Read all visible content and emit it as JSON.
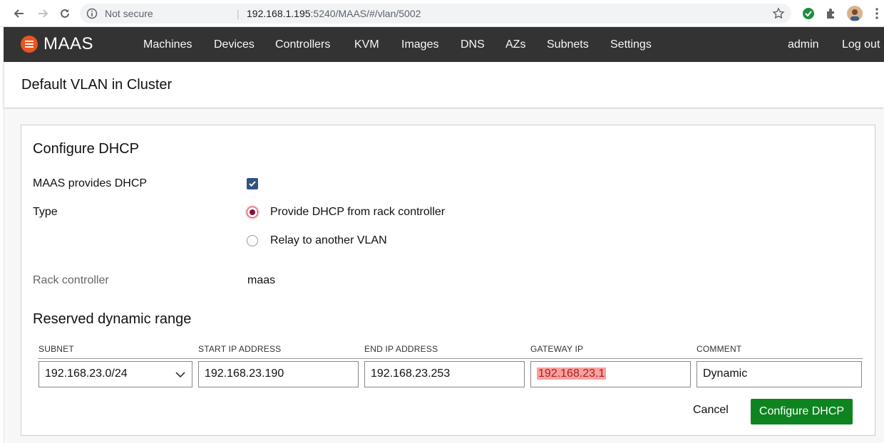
{
  "browser": {
    "security_label": "Not secure",
    "url_host": "192.168.1.195",
    "url_rest": ":5240/MAAS/#/vlan/5002"
  },
  "header": {
    "logo_text": "MAAS",
    "brand_color": "#e95420",
    "nav": [
      "Machines",
      "Devices",
      "Controllers",
      "KVM",
      "Images",
      "DNS",
      "AZs",
      "Subnets",
      "Settings"
    ],
    "user": "admin",
    "logout": "Log out"
  },
  "page": {
    "title": "Default VLAN in Cluster"
  },
  "dhcp": {
    "title": "Configure DHCP",
    "provides_label": "MAAS provides DHCP",
    "provides_checked": true,
    "type_label": "Type",
    "type_options": [
      "Provide DHCP from rack controller",
      "Relay to another VLAN"
    ],
    "type_selected": "Provide DHCP from rack controller",
    "rack_label": "Rack controller",
    "rack_value": "maas"
  },
  "range": {
    "title": "Reserved dynamic range",
    "headers": [
      "SUBNET",
      "START IP ADDRESS",
      "END IP ADDRESS",
      "GATEWAY IP",
      "COMMENT"
    ],
    "subnet": "192.168.23.0/24",
    "start_ip": "192.168.23.190",
    "end_ip": "192.168.23.253",
    "gateway_ip": "192.168.23.1",
    "comment": "Dynamic"
  },
  "actions": {
    "cancel": "Cancel",
    "submit": "Configure DHCP",
    "submit_color": "#0e8420"
  }
}
